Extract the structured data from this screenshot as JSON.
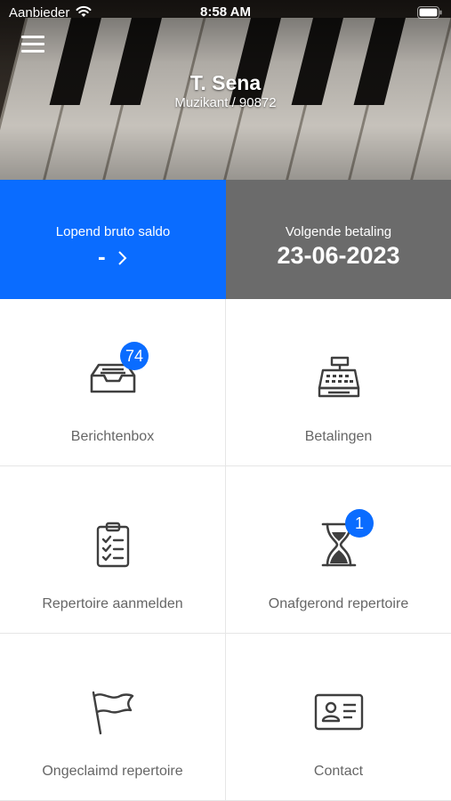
{
  "status_bar": {
    "carrier": "Aanbieder",
    "time": "8:58 AM"
  },
  "header": {
    "name": "T. Sena",
    "subtitle": "Muzikant / 90872"
  },
  "balance": {
    "label": "Lopend bruto saldo",
    "value": "-"
  },
  "payment": {
    "label": "Volgende betaling",
    "date": "23-06-2023"
  },
  "menu": [
    {
      "label": "Berichtenbox",
      "icon": "inbox-icon",
      "badge": "74"
    },
    {
      "label": "Betalingen",
      "icon": "cash-register-icon",
      "badge": null
    },
    {
      "label": "Repertoire aanmelden",
      "icon": "clipboard-check-icon",
      "badge": null
    },
    {
      "label": "Onafgerond repertoire",
      "icon": "hourglass-icon",
      "badge": "1"
    },
    {
      "label": "Ongeclaimd repertoire",
      "icon": "flag-icon",
      "badge": null
    },
    {
      "label": "Contact",
      "icon": "id-card-icon",
      "badge": null
    }
  ],
  "colors": {
    "accent": "#0a6cff",
    "payment_tile": "#6b6b6b",
    "label_text": "#666666"
  }
}
